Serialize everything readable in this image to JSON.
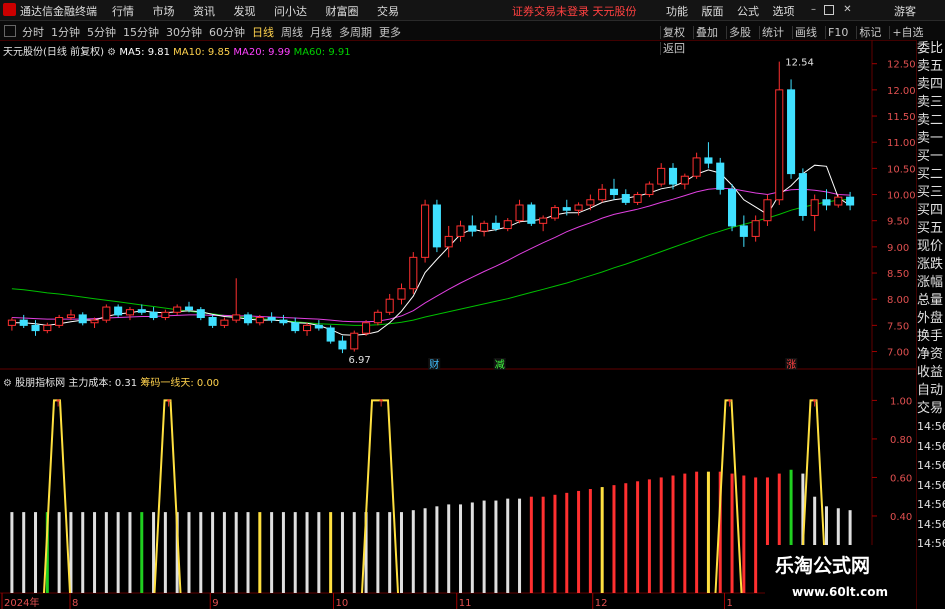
{
  "menubar": {
    "app_title": "通达信金融终端",
    "items": [
      "行情",
      "市场",
      "资讯",
      "发现",
      "问小达",
      "财富圈",
      "交易"
    ],
    "warning": "证券交易未登录  天元股份",
    "right_items": [
      "功能",
      "版面",
      "公式",
      "选项"
    ],
    "guest": "游客"
  },
  "toolbar": {
    "periods": [
      "分时",
      "1分钟",
      "5分钟",
      "15分钟",
      "30分钟",
      "60分钟",
      "日线",
      "周线",
      "月线",
      "多周期",
      "更多"
    ],
    "active_period": "日线",
    "tools": [
      "复权",
      "叠加",
      "多股",
      "统计",
      "画线",
      "F10",
      "标记",
      "+自选",
      "返回"
    ]
  },
  "main_chart": {
    "stock_title": "天元股份(日线 前复权)",
    "ma5": "MA5: 9.81",
    "ma10": "MA10: 9.85",
    "ma20": "MA20: 9.99",
    "ma60": "MA60: 9.91",
    "high_label": "12.54",
    "low_label": "6.97",
    "events": [
      "财",
      "减",
      "涨"
    ]
  },
  "indicator": {
    "name": "股朋指标网",
    "main_cost": "主力成本: 0.31",
    "chip": "筹码一线天: 0.00"
  },
  "side_panel": [
    "委比",
    "卖五",
    "卖四",
    "卖三",
    "卖二",
    "卖一",
    "买一",
    "买二",
    "买三",
    "买四",
    "买五",
    "现价",
    "涨跌",
    "涨幅",
    "总量",
    "外盘",
    "换手",
    "净资",
    "收益",
    "自动",
    "交易",
    "14:56",
    "14:56",
    "14:56",
    "14:56",
    "14:56",
    "14:56",
    "14:56"
  ],
  "chart_data": {
    "type": "candlestick",
    "y_axis_main": [
      "12.50",
      "12.00",
      "11.50",
      "11.00",
      "10.50",
      "10.00",
      "9.50",
      "9.00",
      "8.50",
      "8.00",
      "7.50",
      "7.00"
    ],
    "y_axis_indicator": [
      "1.00",
      "0.80",
      "0.60",
      "0.40"
    ],
    "x_labels": [
      "2024年",
      "8",
      "9",
      "10",
      "11",
      "12",
      "1"
    ],
    "ylim_main": [
      6.8,
      12.8
    ],
    "ylim_indicator": [
      0,
      1.08
    ],
    "candles": [
      [
        7.5,
        7.65,
        7.4,
        7.6
      ],
      [
        7.6,
        7.7,
        7.45,
        7.5
      ],
      [
        7.5,
        7.6,
        7.3,
        7.4
      ],
      [
        7.4,
        7.55,
        7.35,
        7.5
      ],
      [
        7.5,
        7.7,
        7.45,
        7.65
      ],
      [
        7.65,
        7.8,
        7.6,
        7.7
      ],
      [
        7.7,
        7.75,
        7.5,
        7.55
      ],
      [
        7.55,
        7.65,
        7.45,
        7.6
      ],
      [
        7.6,
        7.9,
        7.55,
        7.85
      ],
      [
        7.85,
        7.9,
        7.65,
        7.7
      ],
      [
        7.7,
        7.85,
        7.6,
        7.8
      ],
      [
        7.8,
        7.9,
        7.7,
        7.75
      ],
      [
        7.75,
        7.85,
        7.6,
        7.65
      ],
      [
        7.65,
        7.8,
        7.6,
        7.75
      ],
      [
        7.75,
        7.9,
        7.7,
        7.85
      ],
      [
        7.85,
        7.95,
        7.75,
        7.8
      ],
      [
        7.8,
        7.85,
        7.6,
        7.65
      ],
      [
        7.65,
        7.7,
        7.45,
        7.5
      ],
      [
        7.5,
        7.65,
        7.45,
        7.6
      ],
      [
        7.6,
        8.4,
        7.55,
        7.7
      ],
      [
        7.7,
        7.75,
        7.5,
        7.55
      ],
      [
        7.55,
        7.7,
        7.5,
        7.65
      ],
      [
        7.65,
        7.75,
        7.55,
        7.6
      ],
      [
        7.6,
        7.7,
        7.5,
        7.55
      ],
      [
        7.55,
        7.65,
        7.35,
        7.4
      ],
      [
        7.4,
        7.55,
        7.3,
        7.5
      ],
      [
        7.5,
        7.6,
        7.4,
        7.45
      ],
      [
        7.45,
        7.5,
        7.15,
        7.2
      ],
      [
        7.2,
        7.3,
        6.97,
        7.05
      ],
      [
        7.05,
        7.4,
        7.0,
        7.35
      ],
      [
        7.35,
        7.6,
        7.3,
        7.55
      ],
      [
        7.55,
        7.8,
        7.5,
        7.75
      ],
      [
        7.75,
        8.1,
        7.7,
        8.0
      ],
      [
        8.0,
        8.3,
        7.9,
        8.2
      ],
      [
        8.2,
        8.9,
        8.1,
        8.8
      ],
      [
        8.8,
        9.9,
        8.7,
        9.8
      ],
      [
        9.8,
        9.9,
        8.9,
        9.0
      ],
      [
        9.0,
        9.4,
        8.8,
        9.2
      ],
      [
        9.2,
        9.5,
        9.1,
        9.4
      ],
      [
        9.4,
        9.6,
        9.2,
        9.3
      ],
      [
        9.3,
        9.5,
        9.2,
        9.45
      ],
      [
        9.45,
        9.6,
        9.3,
        9.35
      ],
      [
        9.35,
        9.55,
        9.3,
        9.5
      ],
      [
        9.5,
        9.9,
        9.45,
        9.8
      ],
      [
        9.8,
        9.85,
        9.4,
        9.45
      ],
      [
        9.45,
        9.6,
        9.3,
        9.55
      ],
      [
        9.55,
        9.8,
        9.5,
        9.75
      ],
      [
        9.75,
        9.9,
        9.6,
        9.7
      ],
      [
        9.7,
        9.85,
        9.6,
        9.8
      ],
      [
        9.8,
        10.0,
        9.7,
        9.9
      ],
      [
        9.9,
        10.2,
        9.85,
        10.1
      ],
      [
        10.1,
        10.3,
        9.9,
        10.0
      ],
      [
        10.0,
        10.1,
        9.8,
        9.85
      ],
      [
        9.85,
        10.05,
        9.8,
        10.0
      ],
      [
        10.0,
        10.25,
        9.95,
        10.2
      ],
      [
        10.2,
        10.6,
        10.15,
        10.5
      ],
      [
        10.5,
        10.6,
        10.1,
        10.2
      ],
      [
        10.2,
        10.4,
        10.1,
        10.35
      ],
      [
        10.35,
        10.8,
        10.3,
        10.7
      ],
      [
        10.7,
        11.0,
        10.5,
        10.6
      ],
      [
        10.6,
        10.7,
        10.0,
        10.1
      ],
      [
        10.1,
        10.2,
        9.3,
        9.4
      ],
      [
        9.4,
        9.6,
        9.0,
        9.2
      ],
      [
        9.2,
        9.6,
        9.1,
        9.5
      ],
      [
        9.5,
        10.0,
        9.4,
        9.9
      ],
      [
        9.9,
        12.54,
        9.8,
        12.0
      ],
      [
        12.0,
        12.2,
        10.3,
        10.4
      ],
      [
        10.4,
        10.5,
        9.5,
        9.6
      ],
      [
        9.6,
        10.0,
        9.3,
        9.9
      ],
      [
        9.9,
        10.1,
        9.7,
        9.8
      ],
      [
        9.8,
        10.0,
        9.75,
        9.95
      ],
      [
        9.95,
        10.05,
        9.7,
        9.8
      ]
    ],
    "ma5": [
      7.55,
      7.55,
      7.53,
      7.5,
      7.53,
      7.57,
      7.6,
      7.6,
      7.67,
      7.72,
      7.74,
      7.78,
      7.75,
      7.74,
      7.76,
      7.78,
      7.76,
      7.71,
      7.67,
      7.65,
      7.62,
      7.6,
      7.6,
      7.59,
      7.55,
      7.54,
      7.5,
      7.42,
      7.32,
      7.31,
      7.33,
      7.38,
      7.55,
      7.77,
      8.06,
      8.51,
      8.76,
      9.0,
      9.24,
      9.34,
      9.29,
      9.33,
      9.38,
      9.48,
      9.5,
      9.53,
      9.61,
      9.65,
      9.65,
      9.74,
      9.85,
      9.9,
      9.93,
      9.97,
      10.03,
      10.11,
      10.15,
      10.25,
      10.39,
      10.47,
      10.41,
      10.18,
      9.9,
      9.76,
      9.62,
      10.0,
      10.17,
      10.4,
      10.56,
      10.54,
      9.94,
      9.79
    ],
    "ma20": [
      7.65,
      7.64,
      7.63,
      7.62,
      7.62,
      7.62,
      7.62,
      7.63,
      7.64,
      7.65,
      7.66,
      7.67,
      7.67,
      7.68,
      7.69,
      7.7,
      7.7,
      7.69,
      7.69,
      7.68,
      7.68,
      7.67,
      7.66,
      7.65,
      7.64,
      7.63,
      7.62,
      7.6,
      7.58,
      7.57,
      7.57,
      7.58,
      7.62,
      7.68,
      7.78,
      7.93,
      8.06,
      8.19,
      8.31,
      8.42,
      8.53,
      8.63,
      8.74,
      8.86,
      8.97,
      9.08,
      9.18,
      9.29,
      9.38,
      9.46,
      9.55,
      9.62,
      9.67,
      9.72,
      9.78,
      9.85,
      9.91,
      9.98,
      10.05,
      10.1,
      10.12,
      10.11,
      10.07,
      10.03,
      10.0,
      10.05,
      10.09,
      10.1,
      10.08,
      10.05,
      10.0,
      9.99
    ],
    "ma60": [
      8.2,
      8.18,
      8.15,
      8.12,
      8.1,
      8.07,
      8.04,
      8.01,
      7.98,
      7.95,
      7.92,
      7.89,
      7.86,
      7.83,
      7.8,
      7.77,
      7.74,
      7.72,
      7.69,
      7.67,
      7.65,
      7.63,
      7.61,
      7.59,
      7.57,
      7.55,
      7.53,
      7.52,
      7.51,
      7.5,
      7.5,
      7.51,
      7.53,
      7.56,
      7.6,
      7.66,
      7.71,
      7.76,
      7.81,
      7.86,
      7.91,
      7.96,
      8.01,
      8.07,
      8.13,
      8.19,
      8.25,
      8.31,
      8.38,
      8.45,
      8.52,
      8.6,
      8.67,
      8.75,
      8.83,
      8.91,
      8.99,
      9.07,
      9.15,
      9.23,
      9.3,
      9.37,
      9.43,
      9.49,
      9.55,
      9.62,
      9.7,
      9.76,
      9.81,
      9.86,
      9.89,
      9.91
    ],
    "signal_bars": [
      0.42,
      0.42,
      0.42,
      0.42,
      0.42,
      0.42,
      0.42,
      0.42,
      0.42,
      0.42,
      0.42,
      0.42,
      0.42,
      0.42,
      0.42,
      0.42,
      0.42,
      0.42,
      0.42,
      0.42,
      0.42,
      0.42,
      0.42,
      0.42,
      0.42,
      0.42,
      0.42,
      0.42,
      0.42,
      0.42,
      0.42,
      0.42,
      0.42,
      0.42,
      0.43,
      0.44,
      0.45,
      0.46,
      0.46,
      0.47,
      0.48,
      0.48,
      0.49,
      0.49,
      0.5,
      0.5,
      0.51,
      0.52,
      0.53,
      0.54,
      0.55,
      0.56,
      0.57,
      0.58,
      0.59,
      0.6,
      0.61,
      0.62,
      0.63,
      0.63,
      0.63,
      0.62,
      0.61,
      0.6,
      0.6,
      0.62,
      0.64,
      0.62,
      0.5,
      0.45,
      0.44,
      0.43
    ],
    "peaks": [
      0.06,
      0.19,
      0.44,
      0.85,
      0.95
    ]
  }
}
